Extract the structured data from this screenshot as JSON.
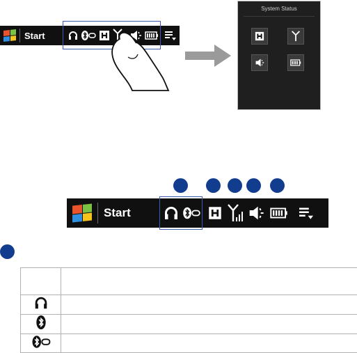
{
  "top_taskbar": {
    "start_label": "Start"
  },
  "system_status_panel": {
    "title": "System Status"
  },
  "bottom_taskbar": {
    "start_label": "Start"
  },
  "colors": {
    "taskbar_bg": "#101010",
    "highlight_border": "#3a5bb0",
    "number_circle": "#123d8f",
    "arrow": "#9a9a9a",
    "panel_bg": "#1f1f1f"
  },
  "legend_table": {
    "rows": [
      {
        "icon": "headset-icon",
        "description": ""
      },
      {
        "icon": "bluetooth-icon",
        "description": ""
      },
      {
        "icon": "bluetooth-stereo-icon",
        "description": ""
      }
    ]
  }
}
